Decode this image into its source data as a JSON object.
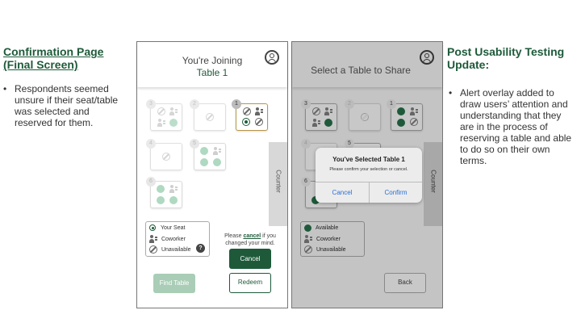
{
  "left_panel": {
    "heading": "Confirmation Page (Final Screen)",
    "bullets": [
      "Respondents seemed unsure if their seat/table was selected and reserved for them."
    ]
  },
  "right_panel": {
    "heading": "Post Usability Testing Update:",
    "bullets": [
      "Alert overlay added to draw users’ attention and understanding that they are in the process of reserving a table and able to do so on their own terms."
    ]
  },
  "screen1": {
    "title_line1": "You're Joining",
    "title_line2": "Table 1",
    "table_numbers": [
      "3",
      "2",
      "1",
      "4",
      "5",
      "6"
    ],
    "counter_label": "Counter",
    "legend": {
      "your_seat": "Your Seat",
      "coworker": "Coworker",
      "unavailable": "Unavailable",
      "help": "?"
    },
    "cancel_note_pre": "Please ",
    "cancel_note_link": "cancel",
    "cancel_note_post": " if you changed your mind.",
    "cancel_button": "Cancel",
    "find_table_button": "Find Table",
    "redeem_button": "Redeem",
    "colors": {
      "brand": "#1e5a3a",
      "light_green": "#8ec9a8"
    }
  },
  "screen2": {
    "title": "Select a Table to Share",
    "table_numbers": [
      "3",
      "2",
      "1",
      "4",
      "5",
      "6"
    ],
    "counter_label": "Counter",
    "legend": {
      "available": "Available",
      "coworker": "Coworker",
      "unavailable": "Unavailable"
    },
    "back_button": "Back",
    "alert": {
      "title": "You've Selected Table 1",
      "message": "Please confirm your selection or cancel.",
      "cancel": "Cancel",
      "confirm": "Confirm",
      "link_color": "#2a6fd6"
    }
  }
}
